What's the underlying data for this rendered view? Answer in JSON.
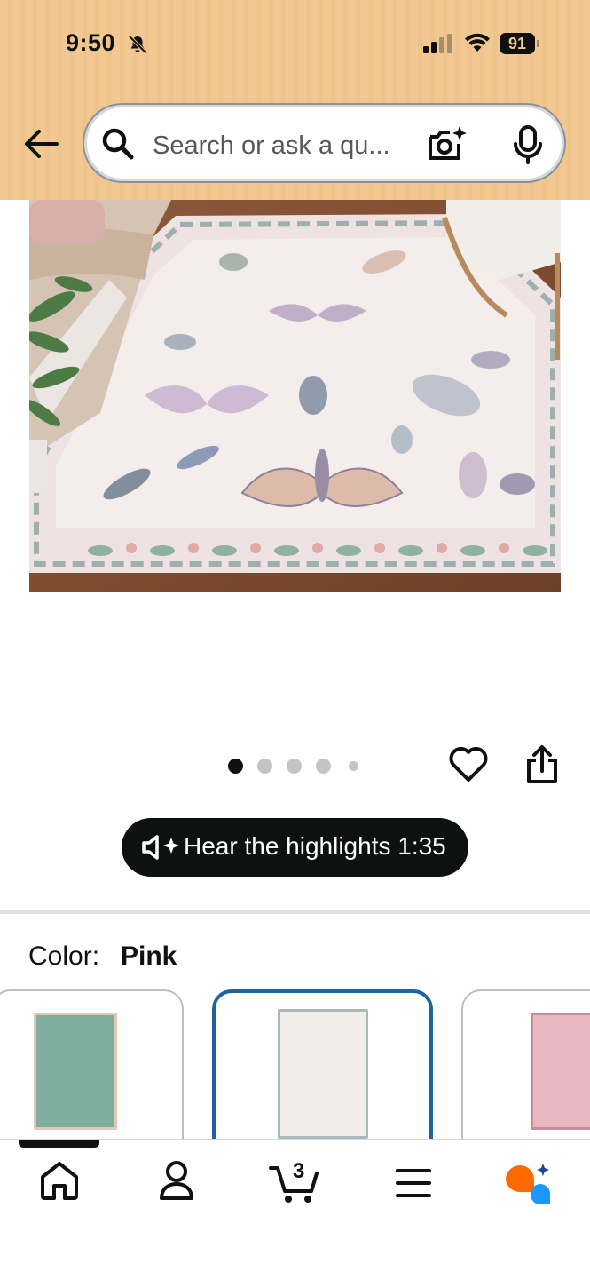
{
  "status_bar": {
    "time": "9:50",
    "battery": "91",
    "icons": [
      "bell-slash-icon",
      "signal-icon",
      "wifi-icon",
      "battery-icon"
    ]
  },
  "header": {
    "background": "#f1c891",
    "back_icon": "arrow-left-icon",
    "search": {
      "placeholder": "Search or ask a question",
      "display_text": "Search or ask a qu...",
      "icons": [
        "search-icon",
        "camera-sparkle-icon",
        "microphone-icon"
      ]
    }
  },
  "gallery": {
    "image_alt": "Pink rug with butterflies, moths, beetles and floral border in a living room",
    "image_count": 5,
    "active_index": 0,
    "actions": [
      "heart-icon",
      "share-icon"
    ]
  },
  "audio": {
    "label": "Hear the highlights 1:35",
    "icon": "speaker-sparkle-icon"
  },
  "variation": {
    "label": "Color:",
    "value": "Pink",
    "swatches": [
      {
        "name": "Green",
        "color": "#7fae9e",
        "selected": false
      },
      {
        "name": "Pink",
        "color": "#f2ecea",
        "selected": true
      },
      {
        "name": "Rose",
        "color": "#e9b7c0",
        "selected": false
      }
    ]
  },
  "bottom_nav": {
    "items": [
      "home-icon",
      "account-icon",
      "cart-icon",
      "menu-icon",
      "rufus-icon"
    ],
    "cart_count": "3"
  }
}
